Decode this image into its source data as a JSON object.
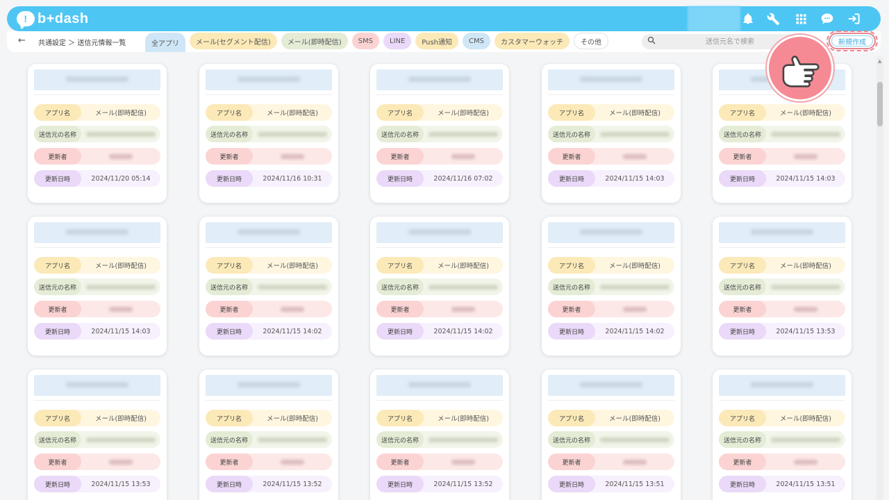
{
  "app": {
    "logo_text": "b+dash",
    "logo_mark": "!"
  },
  "header": {
    "icons": [
      "bell-icon",
      "wrench-icon",
      "grid-icon",
      "chat-icon",
      "logout-icon"
    ]
  },
  "nav": {
    "back_icon": "←",
    "breadcrumb": "共通設定 ＞ 送信元情報一覧",
    "tabs": [
      {
        "label": "全アプリ",
        "active": true
      },
      {
        "label": "メール(セグメント配信)"
      },
      {
        "label": "メール(即時配信)"
      },
      {
        "label": "SMS"
      },
      {
        "label": "LINE"
      },
      {
        "label": "Push通知"
      },
      {
        "label": "CMS"
      },
      {
        "label": "カスタマーウォッチ"
      },
      {
        "label": "その他"
      }
    ],
    "search": {
      "placeholder": "送信元名で検索",
      "value": ""
    },
    "new_button": "新規作成"
  },
  "card_labels": {
    "app_name": "アプリ名",
    "sender_name": "送信元の名称",
    "updater": "更新者",
    "updated_at": "更新日時"
  },
  "cards": [
    {
      "app": "メール(即時配信)",
      "updated": "2024/11/20 05:14"
    },
    {
      "app": "メール(即時配信)",
      "updated": "2024/11/16 10:31"
    },
    {
      "app": "メール(即時配信)",
      "updated": "2024/11/16 07:02"
    },
    {
      "app": "メール(即時配信)",
      "updated": "2024/11/15 14:03"
    },
    {
      "app": "メール(即時配信)",
      "updated": "2024/11/15 14:03"
    },
    {
      "app": "メール(即時配信)",
      "updated": "2024/11/15 14:03"
    },
    {
      "app": "メール(即時配信)",
      "updated": "2024/11/15 14:02"
    },
    {
      "app": "メール(即時配信)",
      "updated": "2024/11/15 14:02"
    },
    {
      "app": "メール(即時配信)",
      "updated": "2024/11/15 14:02"
    },
    {
      "app": "メール(即時配信)",
      "updated": "2024/11/15 13:53"
    },
    {
      "app": "メール(即時配信)",
      "updated": "2024/11/15 13:53"
    },
    {
      "app": "メール(即時配信)",
      "updated": "2024/11/15 13:52"
    },
    {
      "app": "メール(即時配信)",
      "updated": "2024/11/15 13:52"
    },
    {
      "app": "メール(即時配信)",
      "updated": "2024/11/15 13:51"
    },
    {
      "app": "メール(即時配信)",
      "updated": "2024/11/15 13:51"
    }
  ],
  "colors": {
    "header": "#4ec6f4",
    "title_bg": "#e1edf8",
    "app_label": "#fbe9b8",
    "sender_label": "#e4ecd6",
    "updater_label": "#fbd3d3",
    "date_label": "#ead9f8",
    "callout": "#f58a94"
  }
}
